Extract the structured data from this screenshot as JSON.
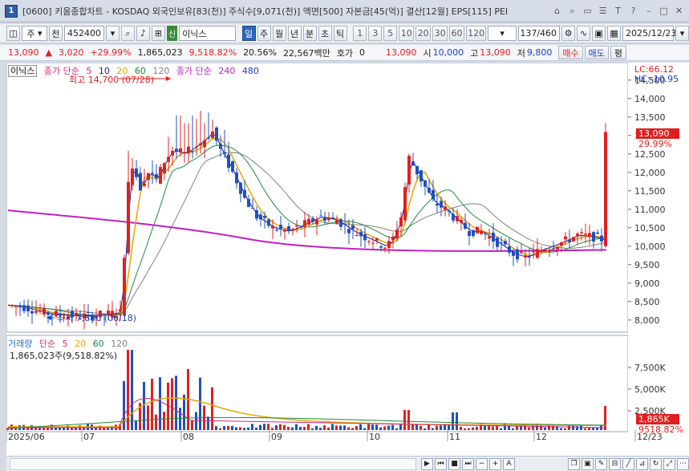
{
  "window": {
    "number": "1",
    "title": "[0600] 키움종합차트 - KOSDAQ 외국인보유[83(천)] 주식수[9,071(천)] 액면[500] 자본금[45(억)] 결산[12월] EPS[115] PEI",
    "controls": [
      "⌂",
      "⌕",
      "▭",
      "☰",
      "T",
      "?",
      "–",
      "□",
      "✕"
    ]
  },
  "toolbar": {
    "market": "주",
    "market_type": "전",
    "code": "452400",
    "badge": "신",
    "name": "이닉스",
    "periods": [
      "일",
      "주",
      "월",
      "년",
      "분",
      "초",
      "틱"
    ],
    "active_period": "일",
    "intervals": [
      "1",
      "3",
      "5",
      "10",
      "20",
      "30",
      "60",
      "120"
    ],
    "count": "137/460",
    "date": "2025/12/23"
  },
  "info": {
    "price": "13,090",
    "change": "3,020",
    "change_pct": "+29.99%",
    "volume": "1,865,023",
    "vol_pct": "9,518.82%",
    "turnover": "20.56%",
    "amount": "22,567백만",
    "hoga_label": "호가",
    "hoga": "0",
    "hoga_price": "13,090",
    "open_label": "시",
    "open": "10,000",
    "high_label": "고",
    "high": "13,090",
    "low_label": "저",
    "low": "9,800",
    "buy": "매수",
    "sell": "매도",
    "eval": "평"
  },
  "price_panel": {
    "name_tag": "이닉스",
    "legend_prefix": "종가 단순",
    "ma": [
      {
        "label": "5",
        "color": "#d0287f"
      },
      {
        "label": "10",
        "color": "#1a1a8c"
      },
      {
        "label": "20",
        "color": "#e5a400"
      },
      {
        "label": "60",
        "color": "#1d8a3a"
      },
      {
        "label": "120",
        "color": "#808080"
      }
    ],
    "legend2_prefix": "종가 단순",
    "ma2": [
      {
        "label": "240",
        "color": "#c020c0"
      },
      {
        "label": "480",
        "color": "#2040c0"
      }
    ],
    "high_note": "최고 14,700 (07/28)",
    "low_note": "최저 7,880 (06/18)",
    "lc": "LC:66.12",
    "hc": "HC:-10.95",
    "current": "13,090",
    "current_pct": "29.99%",
    "y_ticks": [
      "14,500",
      "14,000",
      "13,500",
      "13,000",
      "12,500",
      "12,000",
      "11,500",
      "11,000",
      "10,500",
      "10,000",
      "9,500",
      "9,000",
      "8,500",
      "8,000"
    ]
  },
  "volume_panel": {
    "title": "거래량",
    "legend_prefix": "단순",
    "ma": [
      {
        "label": "5",
        "color": "#d0287f"
      },
      {
        "label": "20",
        "color": "#e5a400"
      },
      {
        "label": "60",
        "color": "#1d8a3a"
      },
      {
        "label": "120",
        "color": "#808080"
      }
    ],
    "current_line": "1,865,023주(9,518.82%)",
    "y_ticks": [
      "7,500K",
      "5,000K",
      "2,500K"
    ],
    "current": "1,865K",
    "current_pct": "9518.82%"
  },
  "x_labels": [
    "2025/06",
    "07",
    "08",
    "09",
    "10",
    "11",
    "12",
    "12/23"
  ],
  "chart_data": {
    "type": "candlestick",
    "ylim": [
      7800,
      14800
    ],
    "x_labels": [
      "2025/06",
      "07",
      "08",
      "09",
      "10",
      "11",
      "12"
    ],
    "last_close": 13090,
    "high": 14700,
    "low": 7880
  }
}
